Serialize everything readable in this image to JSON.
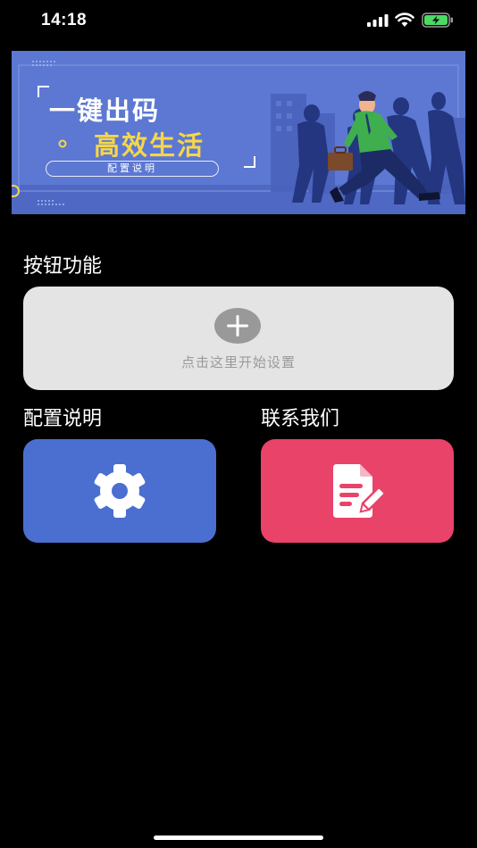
{
  "status_bar": {
    "time": "14:18",
    "icons": [
      "signal-icon",
      "wifi-icon",
      "battery-charging-icon"
    ]
  },
  "banner": {
    "title_line1": "一键出码",
    "title_line2": "高效生活",
    "pill_label": "配置说明",
    "colors": {
      "background": "#5b76cf",
      "highlight": "#f6d64a"
    }
  },
  "button_section": {
    "title": "按钮功能",
    "add_card": {
      "hint": "点击这里开始设置",
      "icon": "plus-circle-icon"
    }
  },
  "config_section": {
    "title": "配置说明",
    "icon": "gear-icon",
    "color": "#4a6fd0"
  },
  "contact_section": {
    "title": "联系我们",
    "icon": "document-edit-icon",
    "color": "#e9436a"
  }
}
